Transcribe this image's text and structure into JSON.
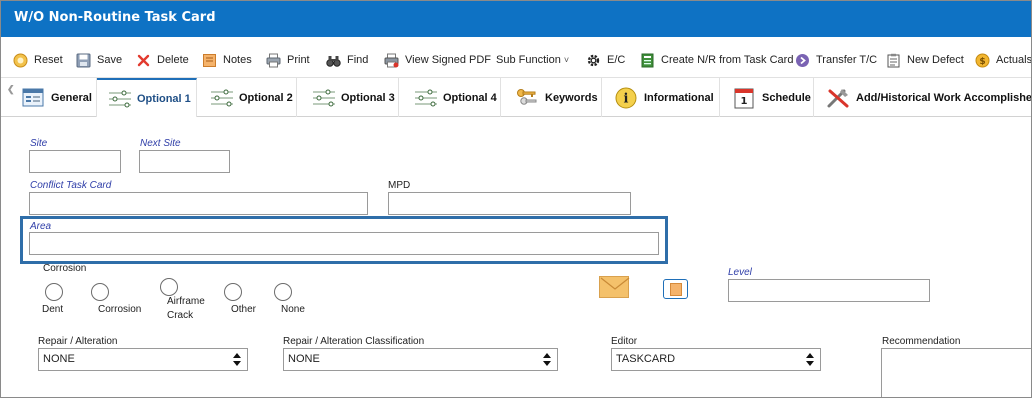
{
  "window": {
    "title": "W/O Non-Routine Task Card"
  },
  "toolbar": {
    "reset": "Reset",
    "save": "Save",
    "delete": "Delete",
    "notes": "Notes",
    "print": "Print",
    "find": "Find",
    "view_signed_pdf": "View Signed PDF",
    "sub_function": "Sub Function",
    "sub_function_caret": "˅",
    "ec": "E/C",
    "create_nr": "Create N/R from Task Card",
    "transfer": "Transfer T/C",
    "new_defect": "New Defect",
    "actuals": "Actuals"
  },
  "tabs": {
    "general": "General",
    "optional1": "Optional 1",
    "optional2": "Optional 2",
    "optional3": "Optional 3",
    "optional4": "Optional 4",
    "keywords": "Keywords",
    "informational": "Informational",
    "schedule": "Schedule",
    "add_historical": "Add/Historical Work Accomplished",
    "active": "optional1",
    "schedule_day": "1",
    "info_glyph": "i"
  },
  "form": {
    "site_label": "Site",
    "site_value": "",
    "next_site_label": "Next Site",
    "next_site_value": "",
    "conflict_label": "Conflict Task Card",
    "conflict_value": "",
    "mpd_label": "MPD",
    "mpd_value": "",
    "area_label": "Area",
    "area_value": "",
    "corrosion_label": "Corrosion",
    "radios": {
      "dent": "Dent",
      "corrosion": "Corrosion",
      "airframe_line1": "Airframe",
      "airframe_line2": "Crack",
      "other": "Other",
      "none": "None"
    },
    "level_label": "Level",
    "level_value": "",
    "repair_label": "Repair / Alteration",
    "repair_value": "NONE",
    "repair_class_label": "Repair / Alteration Classification",
    "repair_class_value": "NONE",
    "editor_label": "Editor",
    "editor_value": "TASKCARD",
    "recommendation_label": "Recommendation",
    "recommendation_value": ""
  },
  "colors": {
    "titlebar": "#0e72c4",
    "highlight": "#2f6ea9",
    "field_label": "#2f3ea8"
  },
  "icons": {
    "reset": "reset-icon",
    "save": "save-icon",
    "delete": "delete-icon",
    "notes": "notes-icon",
    "print": "print-icon",
    "find": "binoculars-icon",
    "pdf": "pdf-print-icon",
    "ec": "gear-icon",
    "create_nr": "document-icon",
    "transfer": "arrow-circle-icon",
    "new_defect": "clipboard-icon",
    "actuals": "coin-icon"
  }
}
